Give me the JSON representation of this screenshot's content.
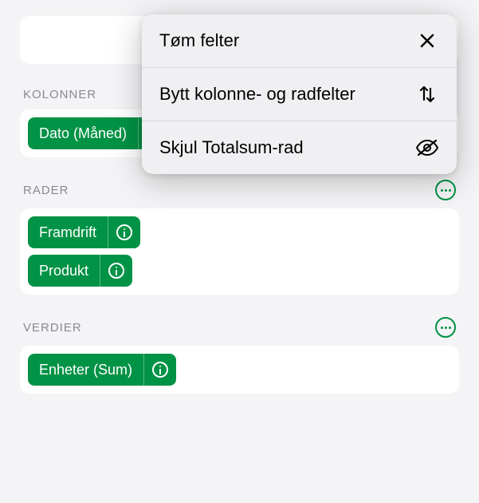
{
  "popover": {
    "items": [
      {
        "label": "Tøm felter"
      },
      {
        "label": "Bytt kolonne- og radfelter"
      },
      {
        "label": "Skjul Totalsum-rad"
      }
    ]
  },
  "sections": {
    "columns": {
      "label": "KOLONNER",
      "pills": [
        {
          "label": "Dato (Måned)"
        }
      ]
    },
    "rows": {
      "label": "RADER",
      "pills": [
        {
          "label": "Framdrift"
        },
        {
          "label": "Produkt"
        }
      ]
    },
    "values": {
      "label": "VERDIER",
      "pills": [
        {
          "label": "Enheter (Sum)"
        }
      ]
    }
  },
  "colors": {
    "accent": "#009245"
  }
}
